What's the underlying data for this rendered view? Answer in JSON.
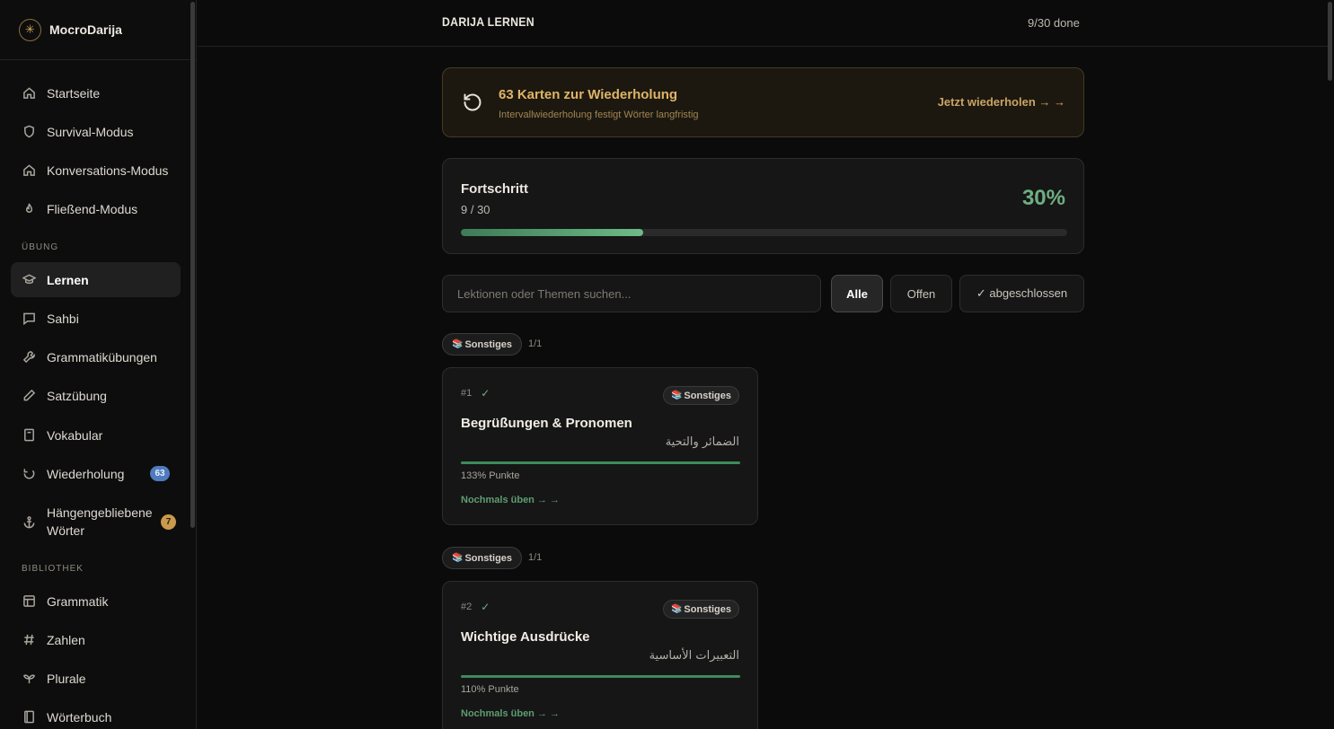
{
  "brand": {
    "logo_glyph": "✳",
    "name": "MocroDarija"
  },
  "sidebar": {
    "main_items": [
      {
        "label": "Startseite",
        "icon": "home-icon"
      },
      {
        "label": "Survival-Modus",
        "icon": "shield-icon"
      },
      {
        "label": "Konversations-Modus",
        "icon": "home-icon"
      },
      {
        "label": "Fließend-Modus",
        "icon": "flame-icon"
      }
    ],
    "section_practice": "ÜBUNG",
    "practice_items": [
      {
        "label": "Lernen",
        "icon": "graduation-cap-icon",
        "active": true
      },
      {
        "label": "Sahbi",
        "icon": "chat-bubble-icon"
      },
      {
        "label": "Grammatikübungen",
        "icon": "wrench-icon"
      },
      {
        "label": "Satzübung",
        "icon": "pencil-icon"
      },
      {
        "label": "Vokabular",
        "icon": "notebook-icon"
      },
      {
        "label": "Wiederholung",
        "icon": "refresh-icon",
        "badge": "63"
      },
      {
        "label": "Hängengebliebene Wörter",
        "icon": "anchor-icon",
        "badge": "7"
      }
    ],
    "section_library": "BIBLIOTHEK",
    "library_items": [
      {
        "label": "Grammatik",
        "icon": "layout-icon"
      },
      {
        "label": "Zahlen",
        "icon": "hash-icon"
      },
      {
        "label": "Plurale",
        "icon": "sprout-icon"
      },
      {
        "label": "Wörterbuch",
        "icon": "book-icon"
      }
    ]
  },
  "header": {
    "title": "DARIJA LERNEN",
    "status": "9/30 done"
  },
  "review": {
    "title": "63 Karten zur Wiederholung",
    "subtitle": "Intervallwiederholung festigt Wörter langfristig",
    "action": "Jetzt wiederholen → →"
  },
  "progress": {
    "title": "Fortschritt",
    "count": "9 / 30",
    "percent": "30%",
    "fraction": 0.3
  },
  "search": {
    "placeholder": "Lektionen oder Themen suchen..."
  },
  "filters": {
    "all": "Alle",
    "open": "Offen",
    "done": "✓ abgeschlossen"
  },
  "groups": [
    {
      "emoji": "📚",
      "name": "Sonstiges",
      "count": "1/1",
      "lesson": {
        "number": "#1",
        "check": "✓",
        "tag": "Sonstiges",
        "title": "Begrüßungen & Pronomen",
        "arabic": "الضمائر والتحية",
        "points": "133% Punkte",
        "progress_fraction": 1.0,
        "action": "Nochmals üben → →"
      }
    },
    {
      "emoji": "📚",
      "name": "Sonstiges",
      "count": "1/1",
      "lesson": {
        "number": "#2",
        "check": "✓",
        "tag": "Sonstiges",
        "title": "Wichtige Ausdrücke",
        "arabic": "التعبيرات الأساسية",
        "points": "110% Punkte",
        "progress_fraction": 1.0,
        "action": "Nochmals üben → →"
      }
    }
  ],
  "colors": {
    "accent_gold": "#e0b466",
    "accent_green": "#6fae82",
    "badge_blue": "#4f7bbf",
    "badge_gold": "#c99a4b"
  }
}
